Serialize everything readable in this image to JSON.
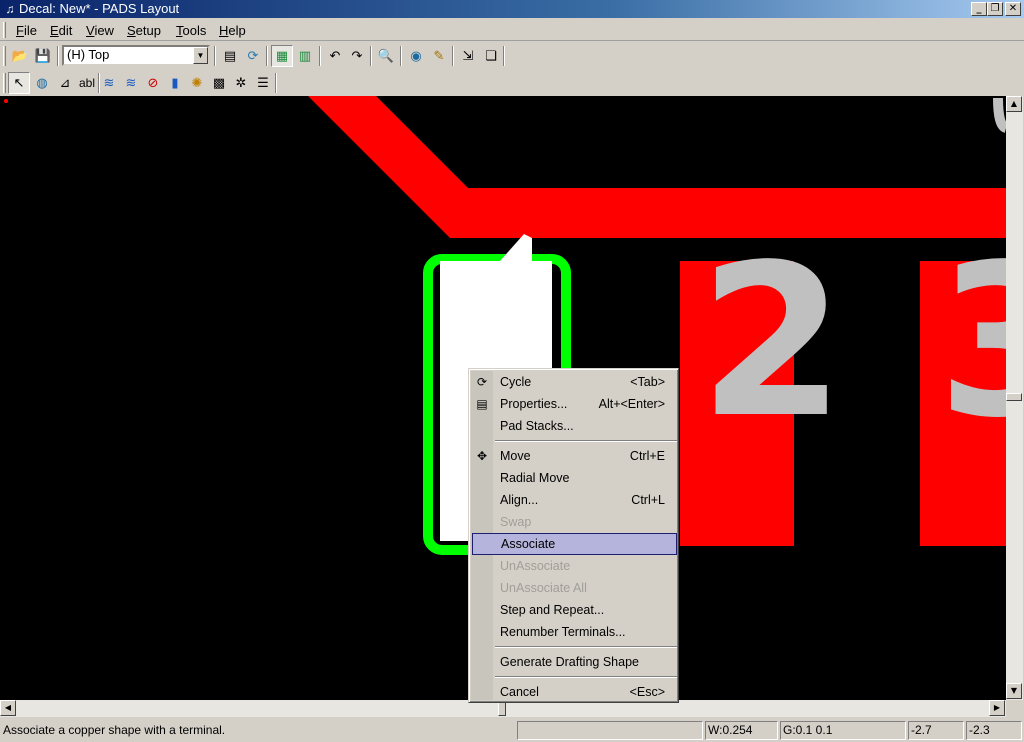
{
  "window": {
    "title": "Decal: New* - PADS Layout",
    "app_icon": "pads-app-icon",
    "controls": [
      "minimize-icon",
      "restore-icon",
      "close-icon"
    ],
    "control_glyphs": {
      "minimize": "_",
      "restore": "❐",
      "close": "✕"
    }
  },
  "menubar": {
    "items": [
      {
        "label": "File",
        "accel": "F",
        "rest": "ile"
      },
      {
        "label": "Edit",
        "accel": "E",
        "rest": "dit"
      },
      {
        "label": "View",
        "accel": "V",
        "rest": "iew"
      },
      {
        "label": "Setup",
        "accel": "S",
        "rest": "etup"
      },
      {
        "label": "Tools",
        "accel": "T",
        "rest": "ools"
      },
      {
        "label": "Help",
        "accel": "H",
        "rest": "elp"
      }
    ]
  },
  "toolbar1": {
    "layer_select": {
      "value": "(H) Top",
      "dropdown_glyph": "▼"
    },
    "icons": {
      "open": "📂",
      "save": "💾",
      "properties": "▤",
      "cycle": "⟳",
      "display_colors": "▦",
      "layers": "▥",
      "undo": "↶",
      "redo": "↷",
      "zoom": "🔍",
      "view_3d": "◉",
      "drafting": "✎",
      "export": "⇲",
      "windows": "❏"
    }
  },
  "toolbar2": {
    "icons": {
      "select": "↖",
      "modeless": "◍",
      "pin": "⊿",
      "text": "abl",
      "planes1": "≋",
      "planes2": "≋",
      "no_entry": "⊘",
      "library": "▮",
      "sun": "✺",
      "grid": "▩",
      "dxf": "✲",
      "list": "☰"
    },
    "text_tool_label": "abl"
  },
  "canvas": {
    "colors": {
      "background": "#000000",
      "copper": "#ff0000",
      "outline": "#00ff00",
      "terminal_text": "#c0c0c0",
      "pad_fill": "#ffffff"
    },
    "terminal_numbers": [
      "2",
      "3"
    ]
  },
  "context_menu": {
    "items": [
      {
        "type": "item",
        "label": "Cycle",
        "shortcut": "<Tab>",
        "icon": "cycle-icon",
        "glyph": "⟳",
        "enabled": true
      },
      {
        "type": "item",
        "label": "Properties...",
        "shortcut": "Alt+<Enter>",
        "icon": "properties-icon",
        "glyph": "▤",
        "enabled": true
      },
      {
        "type": "item",
        "label": "Pad Stacks...",
        "shortcut": "",
        "enabled": true
      },
      {
        "type": "separator"
      },
      {
        "type": "item",
        "label": "Move",
        "shortcut": "Ctrl+E",
        "icon": "move-icon",
        "glyph": "✥",
        "enabled": true
      },
      {
        "type": "item",
        "label": "Radial Move",
        "shortcut": "",
        "enabled": true
      },
      {
        "type": "item",
        "label": "Align...",
        "shortcut": "Ctrl+L",
        "enabled": true
      },
      {
        "type": "item",
        "label": "Swap",
        "shortcut": "",
        "enabled": false
      },
      {
        "type": "item",
        "label": "Associate",
        "shortcut": "",
        "enabled": true,
        "highlighted": true
      },
      {
        "type": "item",
        "label": "UnAssociate",
        "shortcut": "",
        "enabled": false
      },
      {
        "type": "item",
        "label": "UnAssociate All",
        "shortcut": "",
        "enabled": false
      },
      {
        "type": "item",
        "label": "Step and Repeat...",
        "shortcut": "",
        "enabled": true
      },
      {
        "type": "item",
        "label": "Renumber Terminals...",
        "shortcut": "",
        "enabled": true
      },
      {
        "type": "separator"
      },
      {
        "type": "item",
        "label": "Generate Drafting Shape",
        "shortcut": "",
        "enabled": true
      },
      {
        "type": "separator"
      },
      {
        "type": "item",
        "label": "Cancel",
        "shortcut": "<Esc>",
        "enabled": true
      }
    ]
  },
  "scrollbars": {
    "up": "▲",
    "down": "▼",
    "left": "◀",
    "right": "▶"
  },
  "statusbar": {
    "message": "Associate a copper shape with a terminal.",
    "panel_blank": "",
    "width": "W:0.254",
    "grid": "G:0.1 0.1",
    "x": "-2.7",
    "y": "-2.3"
  }
}
